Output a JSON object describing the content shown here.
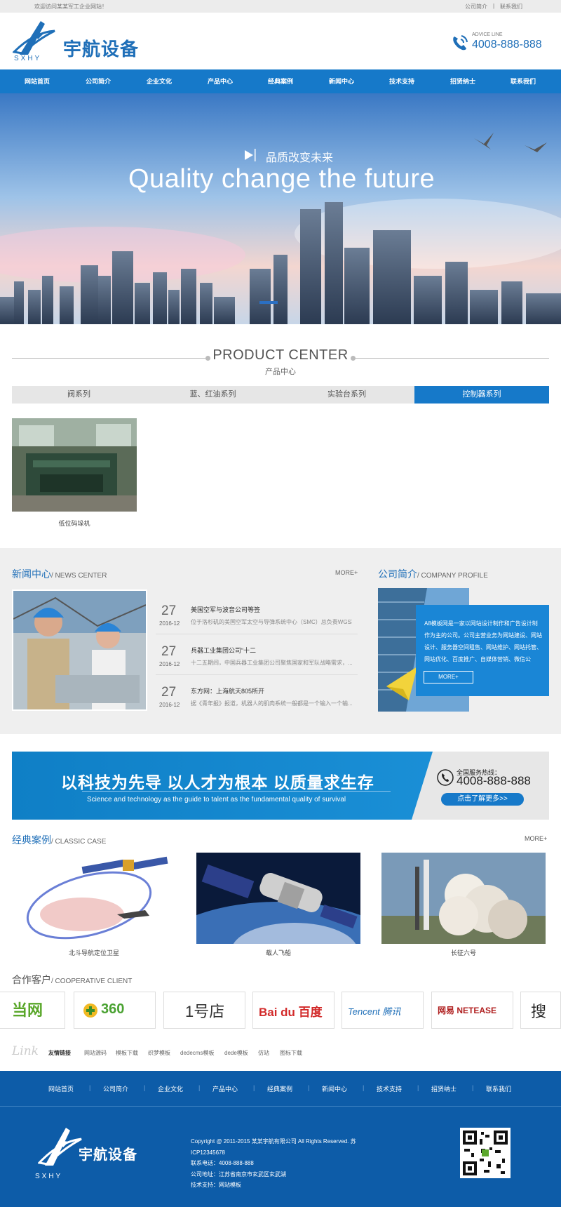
{
  "topbar": {
    "welcome": "欢迎访问某某军工企业网站！",
    "links": [
      "公司简介",
      "联系我们"
    ],
    "sep": "|"
  },
  "header": {
    "logo_text": "宇航设备",
    "logo_sub": "SXHY",
    "advice_label": "ADVICE LINE",
    "advice_phone": "4008-888-888"
  },
  "nav": [
    "网站首页",
    "公司简介",
    "企业文化",
    "产品中心",
    "经典案例",
    "新闻中心",
    "技术支持",
    "招贤纳士",
    "联系我们"
  ],
  "banner": {
    "subtitle": "品质改变未来",
    "headline": "Quality change the future"
  },
  "products": {
    "title_en": "PRODUCT CENTER",
    "title_cn": "产品中心",
    "tabs": [
      "阀系列",
      "蓝、红油系列",
      "实验台系列",
      "控制器系列"
    ],
    "active_tab": 3,
    "items": [
      {
        "caption": "低位码垛机"
      }
    ]
  },
  "news": {
    "title_cn": "新闻中心",
    "title_en": "/ NEWS CENTER",
    "more": "MORE+",
    "items": [
      {
        "day": "27",
        "ym": "2016-12",
        "title": "美国空军与波音公司等签",
        "desc": "位于洛杉矶的美国空军太空与导弹系统中心（SMC）总负责WGS项"
      },
      {
        "day": "27",
        "ym": "2016-12",
        "title": "兵器工业集团公司“十二",
        "desc": "十二五期间，中国兵器工业集团公司聚焦国家和军队战略需求，......"
      },
      {
        "day": "27",
        "ym": "2016-12",
        "title": "东方网：上海航天805所开",
        "desc": "据《青年报》报道，机器人的肌肉系统一般都是一个输入一个输......"
      }
    ]
  },
  "company": {
    "title_cn": "公司简介",
    "title_en": "/ COMPANY PROFILE",
    "text": "A8模板网是一家以网站设计制作和广告设计制作为主的公司。公司主营业务为网站建设、网站设计、服务器空间租售、网站维护、网站托管、网站优化、百度推广、自媒体营销、微信公",
    "more": "MORE+"
  },
  "slogan": {
    "cn": "以科技为先导 以人才为根本 以质量求生存",
    "en": "Science and technology as the guide to talent as the fundamental quality of survival",
    "hotline_label": "全国服务热线：",
    "hotline": "4008-888-888",
    "button": "点击了解更多>>"
  },
  "cases": {
    "title_cn": "经典案例",
    "title_en": "/ CLASSIC CASE",
    "more": "MORE+",
    "items": [
      {
        "caption": "北斗导航定位卫星"
      },
      {
        "caption": "载人飞船"
      },
      {
        "caption": "长征六号"
      }
    ]
  },
  "clients": {
    "title_cn": "合作客户",
    "title_en": "/ COOPERATIVE CLIENT",
    "logos": [
      "当网",
      "360",
      "1号店",
      "Bai du 百度",
      "Tencent 腾讯",
      "网易 NETEASE",
      "搜"
    ]
  },
  "links": {
    "script": "Link",
    "label": "友情链接",
    "items": [
      "网站源码",
      "模板下载",
      "织梦模板",
      "dedecms模板",
      "dede模板",
      "仿站",
      "图标下载"
    ]
  },
  "footer": {
    "nav": [
      "网站首页",
      "公司简介",
      "企业文化",
      "产品中心",
      "经典案例",
      "新闻中心",
      "技术支持",
      "招贤纳士",
      "联系我们"
    ],
    "logo_text": "宇航设备",
    "logo_sub": "SXHY",
    "copyright": "Copyright @ 2011-2015 某某宇航有限公司 All Rights Reserved.  苏ICP12345678",
    "phone": "联系电话：4008-888-888",
    "address": "公司地址：江苏省南京市玄武区玄武湖",
    "support": "技术支持：网站模板"
  },
  "colors": {
    "primary": "#1679c9",
    "dark": "#0d5ca8",
    "accent": "#1f6fb8"
  }
}
